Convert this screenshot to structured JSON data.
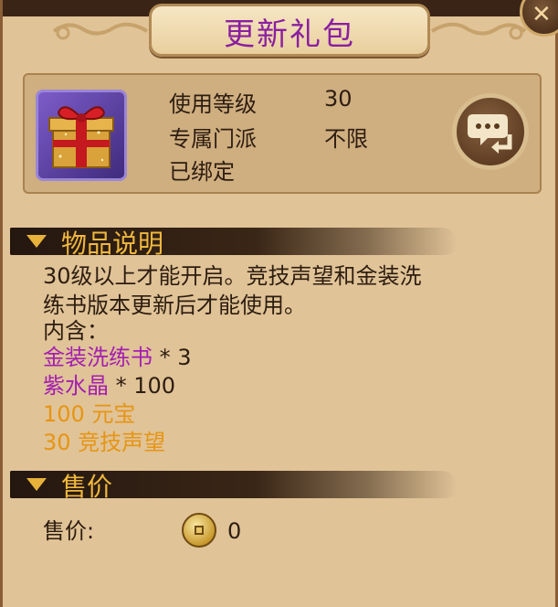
{
  "title": "更新礼包",
  "close_icon": "close-icon",
  "item": {
    "icon": "gift-box-icon",
    "level_label": "使用等级",
    "level_value": "30",
    "school_label": "专属门派",
    "school_value": "不限",
    "bound_status": "已绑定"
  },
  "chat_button_icon": "chat-reply-icon",
  "description_section": {
    "header": "物品说明",
    "line1": "30级以上才能开启。竞技声望和金装洗",
    "line2": "练书版本更新后才能使用。",
    "contents_label": "内含：",
    "contents": [
      {
        "name": "金装洗练书",
        "qty": " * 3"
      },
      {
        "name": "紫水晶",
        "qty": " * 100"
      }
    ],
    "rewards": [
      "100 元宝",
      "30 竞技声望"
    ]
  },
  "price_section": {
    "header": "售价",
    "label": "售价:",
    "value": "0",
    "coin_icon": "copper-coin-icon"
  },
  "colors": {
    "title": "#8a1fa0",
    "purple_item": "#a41fb0",
    "orange_reward": "#e69514",
    "section_header": "#f0b83d"
  }
}
